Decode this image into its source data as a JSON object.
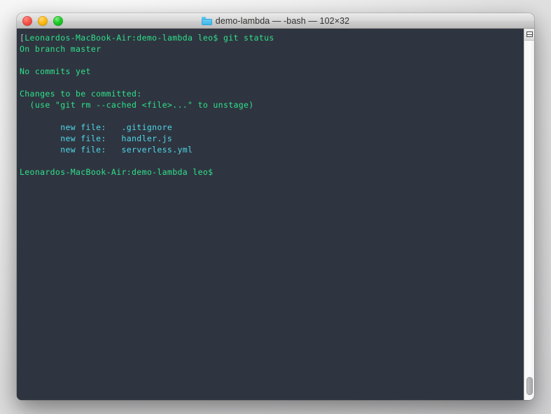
{
  "window": {
    "title": "demo-lambda — -bash — 102×32",
    "folder_icon": "folder-icon",
    "controls": {
      "close_label": "close",
      "minimize_label": "minimize",
      "zoom_label": "zoom"
    }
  },
  "scrollbar": {
    "pane_split_icon": "pane-split-icon"
  },
  "terminal": {
    "background_color": "#2f3540",
    "prompt_color": "#2fe08a",
    "staged_file_color": "#4fd6e8",
    "bracket_color": "#b6bcc4",
    "lines": {
      "l01_bracket": "[",
      "l01_prompt": "Leonardos-MacBook-Air:demo-lambda leo$ git status",
      "l02": "On branch master",
      "l03": "",
      "l04": "No commits yet",
      "l05": "",
      "l06": "Changes to be committed:",
      "l07": "  (use \"git rm --cached <file>...\" to unstage)",
      "l08": "",
      "l09": "        new file:   .gitignore",
      "l10": "        new file:   handler.js",
      "l11": "        new file:   serverless.yml",
      "l12": "",
      "l13": "Leonardos-MacBook-Air:demo-lambda leo$"
    }
  }
}
